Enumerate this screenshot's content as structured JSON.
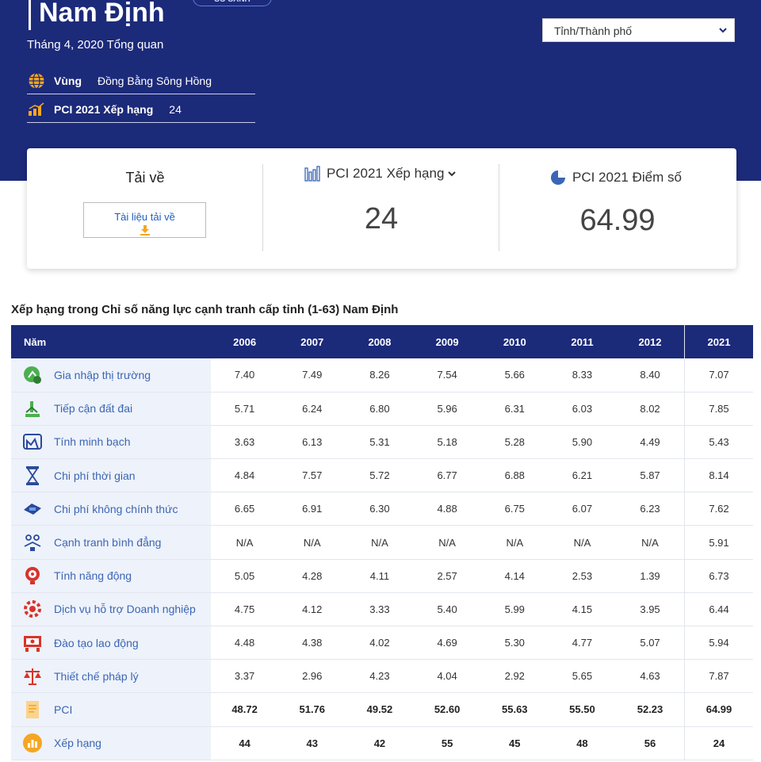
{
  "header": {
    "province": "Nam Định",
    "compare_label": "SO SÁNH",
    "subtitle": "Tháng 4, 2020 Tổng quan",
    "region_label": "Vùng",
    "region_value": "Đồng Bằng Sông Hồng",
    "rank_label": "PCI 2021 Xếp hạng",
    "rank_value": "24",
    "select_value": "Tỉnh/Thành phố"
  },
  "summary": {
    "download_title": "Tải về",
    "download_button": "Tài liệu tải về",
    "rank_heading": "PCI 2021 Xếp hạng",
    "rank_value": "24",
    "score_heading": "PCI 2021 Điểm số",
    "score_value": "64.99"
  },
  "table": {
    "title": "Xếp hạng trong Chỉ số năng lực cạnh tranh cấp tỉnh (1-63) Nam Định",
    "year_header": "Năm",
    "years": [
      "2006",
      "2007",
      "2008",
      "2009",
      "2010",
      "2011",
      "2012",
      "2021"
    ],
    "rows": [
      {
        "name": "Gia nhập thị trường",
        "icon": "market-entry-icon",
        "values": [
          "7.40",
          "7.49",
          "8.26",
          "7.54",
          "5.66",
          "8.33",
          "8.40",
          "7.07"
        ]
      },
      {
        "name": "Tiếp cận đất đai",
        "icon": "land-access-icon",
        "values": [
          "5.71",
          "6.24",
          "6.80",
          "5.96",
          "6.31",
          "6.03",
          "8.02",
          "7.85"
        ]
      },
      {
        "name": "Tính minh bạch",
        "icon": "transparency-icon",
        "values": [
          "3.63",
          "6.13",
          "5.31",
          "5.18",
          "5.28",
          "5.90",
          "4.49",
          "5.43"
        ]
      },
      {
        "name": "Chi phí thời gian",
        "icon": "hourglass-icon",
        "values": [
          "4.84",
          "7.57",
          "5.72",
          "6.77",
          "6.88",
          "6.21",
          "5.87",
          "8.14"
        ]
      },
      {
        "name": "Chi phí không chính thức",
        "icon": "informal-cost-icon",
        "values": [
          "6.65",
          "6.91",
          "6.30",
          "4.88",
          "6.75",
          "6.07",
          "6.23",
          "7.62"
        ]
      },
      {
        "name": "Cạnh tranh bình đẳng",
        "icon": "fair-competition-icon",
        "values": [
          "N/A",
          "N/A",
          "N/A",
          "N/A",
          "N/A",
          "N/A",
          "N/A",
          "5.91"
        ]
      },
      {
        "name": "Tính năng động",
        "icon": "dynamism-icon",
        "values": [
          "5.05",
          "4.28",
          "4.11",
          "2.57",
          "4.14",
          "2.53",
          "1.39",
          "6.73"
        ]
      },
      {
        "name": "Dịch vụ hỗ trợ Doanh nghiệp",
        "icon": "business-support-icon",
        "values": [
          "4.75",
          "4.12",
          "3.33",
          "5.40",
          "5.99",
          "4.15",
          "3.95",
          "6.44"
        ]
      },
      {
        "name": "Đào tạo lao động",
        "icon": "labor-training-icon",
        "values": [
          "4.48",
          "4.38",
          "4.02",
          "4.69",
          "5.30",
          "4.77",
          "5.07",
          "5.94"
        ]
      },
      {
        "name": "Thiết chế pháp lý",
        "icon": "legal-scale-icon",
        "values": [
          "3.37",
          "2.96",
          "4.23",
          "4.04",
          "2.92",
          "5.65",
          "4.63",
          "7.87"
        ]
      },
      {
        "name": "PCI",
        "icon": "pci-document-icon",
        "bold": true,
        "values": [
          "48.72",
          "51.76",
          "49.52",
          "52.60",
          "55.63",
          "55.50",
          "52.23",
          "64.99"
        ]
      },
      {
        "name": "Xếp hạng",
        "icon": "ranking-icon",
        "bold": true,
        "values": [
          "44",
          "43",
          "42",
          "55",
          "45",
          "48",
          "56",
          "24"
        ]
      }
    ]
  },
  "colors": {
    "navy": "#1c2a7a",
    "link": "#3b66b5",
    "icon_red": "#d9332b",
    "icon_blue": "#2a4a9c",
    "icon_green": "#4caf50",
    "icon_orange": "#f5a623"
  }
}
